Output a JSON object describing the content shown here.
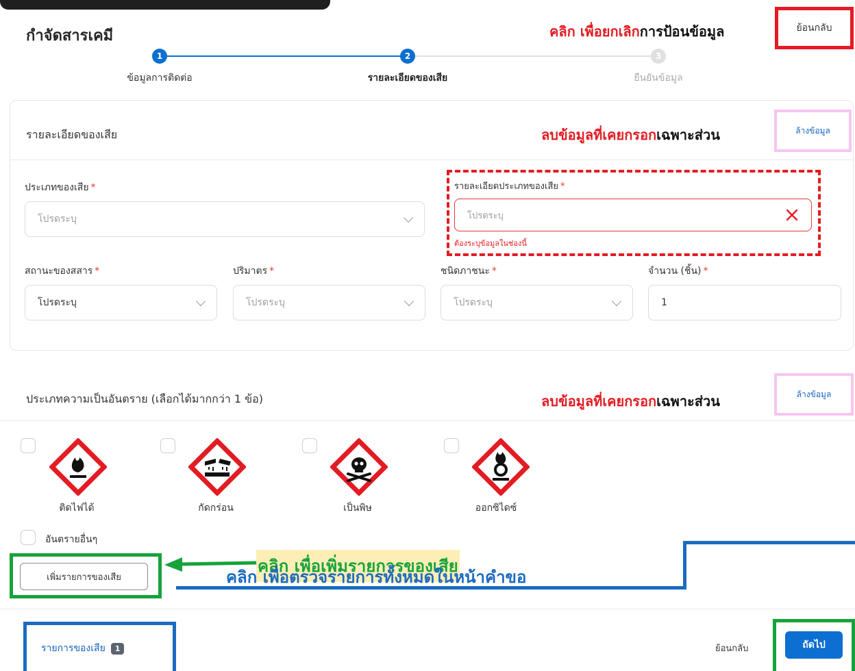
{
  "page": {
    "title": "กำจัดสารเคมี",
    "back_button": "ย้อนกลับ"
  },
  "stepper": {
    "steps": [
      {
        "number": "1",
        "label": "ข้อมูลการติดต่อ",
        "state": "done"
      },
      {
        "number": "2",
        "label": "รายละเอียดของเสีย",
        "state": "active"
      },
      {
        "number": "3",
        "label": "ยืนยันข้อมูล",
        "state": "pending"
      }
    ]
  },
  "annotations": {
    "cancel_prefix": "คลิก เพื่อยกเลิก",
    "cancel_suffix": "การป้อนข้อมูล",
    "clear_prefix": "ลบข้อมูลที่เคยกรอก",
    "clear_suffix": "เฉพาะส่วน",
    "add_item": "คลิก เพื่อเพิ่มรายการของเสีย",
    "review_all": "คลิก เพื่อตรวจรายการทั้งหมดในหน้าคำขอ"
  },
  "waste_detail": {
    "title": "รายละเอียดของเสีย",
    "clear_label": "ล้างข้อมูล",
    "waste_type": {
      "label": "ประเภทของเสีย",
      "placeholder": "โปรดระบุ"
    },
    "waste_type_detail": {
      "label": "รายละเอียดประเภทของเสีย",
      "placeholder": "โปรดระบุ",
      "error": "ต้องระบุข้อมูลในช่องนี้"
    },
    "state": {
      "label": "สถานะของสสาร",
      "value": "โปรดระบุ"
    },
    "volume": {
      "label": "ปริมาตร",
      "placeholder": "โปรดระบุ"
    },
    "container": {
      "label": "ชนิดภาชนะ",
      "placeholder": "โปรดระบุ"
    },
    "quantity": {
      "label": "จำนวน (ชิ้น)",
      "value": "1"
    },
    "required_mark": "*"
  },
  "hazard": {
    "title": "ประเภทความเป็นอันตราย (เลือกได้มากกว่า 1 ข้อ)",
    "clear_label": "ล้างข้อมูล",
    "items": [
      {
        "label": "ติดไฟได้",
        "icon": "flammable-icon",
        "checked": false
      },
      {
        "label": "กัดกร่อน",
        "icon": "corrosive-icon",
        "checked": false
      },
      {
        "label": "เป็นพิษ",
        "icon": "toxic-icon",
        "checked": false
      },
      {
        "label": "ออกซิไดซ์",
        "icon": "oxidizer-icon",
        "checked": false
      }
    ],
    "other_label": "อันตรายอื่นๆ"
  },
  "actions": {
    "add_item": "เพิ่มรายการของเสีย"
  },
  "footer": {
    "items_label": "รายการของเสีย",
    "items_count": "1",
    "back": "ย้อนกลับ",
    "next": "ถัดไป"
  },
  "colors": {
    "red_annotation": "#e31b23",
    "green_annotation": "#16a33b",
    "blue_annotation": "#1b6bc0",
    "primary": "#0d6fd1",
    "pink_highlight": "#f6c6f0"
  }
}
